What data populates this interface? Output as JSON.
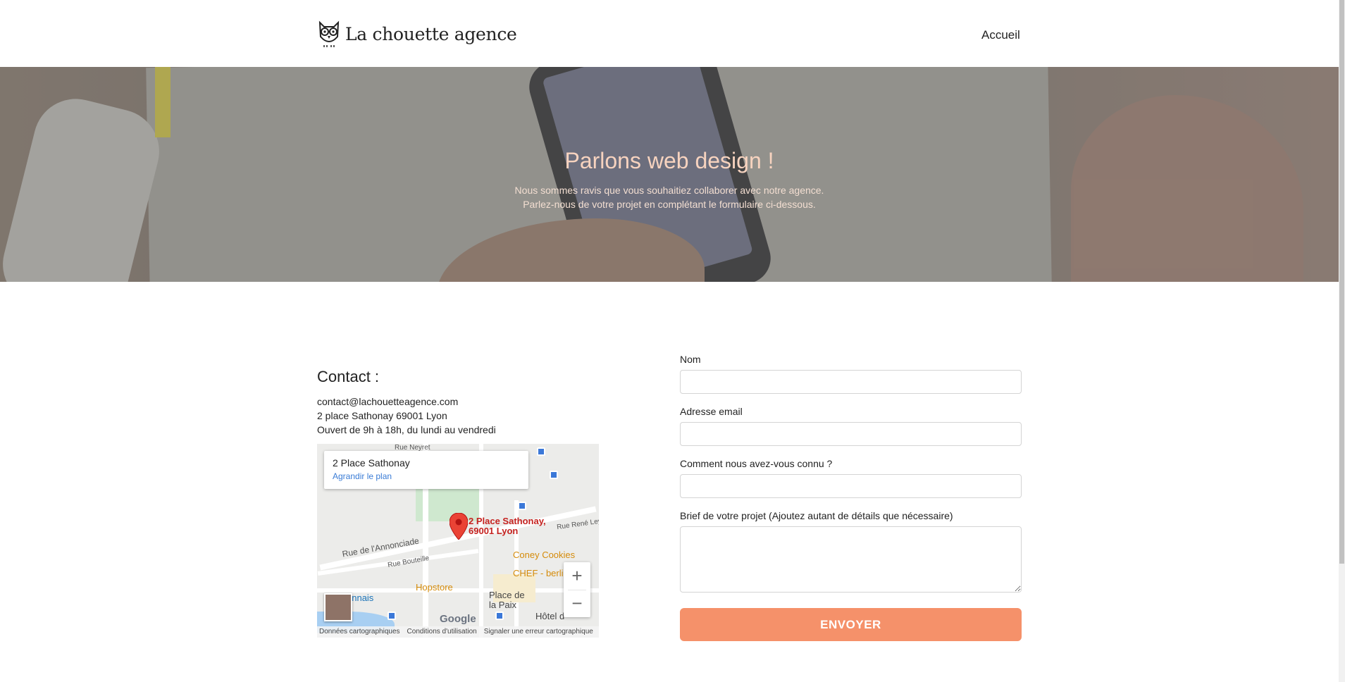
{
  "header": {
    "logo_text": "La chouette agence",
    "nav": {
      "accueil": "Accueil"
    }
  },
  "hero": {
    "title": "Parlons web design !",
    "line1": "Nous sommes ravis que vous souhaitiez collaborer avec notre agence.",
    "line2": "Parlez-nous de votre projet en complétant le formulaire ci-dessous."
  },
  "contact": {
    "title": "Contact :",
    "email": "contact@lachouetteagence.com",
    "address": "2 place Sathonay 69001 Lyon",
    "hours": "Ouvert de 9h à 18h, du lundi au vendredi"
  },
  "map": {
    "card_title": "2 Place Sathonay",
    "card_link": "Agrandir le plan",
    "pin_label_1": "2 Place Sathonay,",
    "pin_label_2": "69001 Lyon",
    "streets": {
      "rue_neyret": "Rue Neyret",
      "rue_annonciade": "Rue de l'Annonciade",
      "rue_bouteille": "Rue Bouteille",
      "rue_rene_leynaud": "Rue René Leyna"
    },
    "pois": {
      "coney": "Coney Cookies",
      "chef": "CHEF - berli",
      "hopstore": "Hopstore",
      "place_paix_1": "Place de",
      "place_paix_2": "la Paix",
      "hotel": "Hôtel d",
      "onnais": "onnais"
    },
    "zoom_in": "+",
    "zoom_out": "−",
    "google": "Google",
    "footer": {
      "data": "Données cartographiques",
      "terms": "Conditions d'utilisation",
      "report": "Signaler une erreur cartographique"
    }
  },
  "form": {
    "name_label": "Nom",
    "name_value": "",
    "email_label": "Adresse email",
    "email_value": "",
    "source_label": "Comment nous avez-vous connu ?",
    "source_value": "",
    "brief_label": "Brief de votre projet (Ajoutez autant de détails que nécessaire)",
    "brief_value": "",
    "submit_label": "ENVOYER"
  },
  "colors": {
    "accent": "#f5916a",
    "hero_title": "#f7d3bf",
    "link": "#3a7cd6",
    "pin": "#ea4335"
  },
  "icons": {
    "logo": "owl-icon",
    "map_pin": "map-pin-icon",
    "bus_stop": "bus-stop-icon"
  }
}
